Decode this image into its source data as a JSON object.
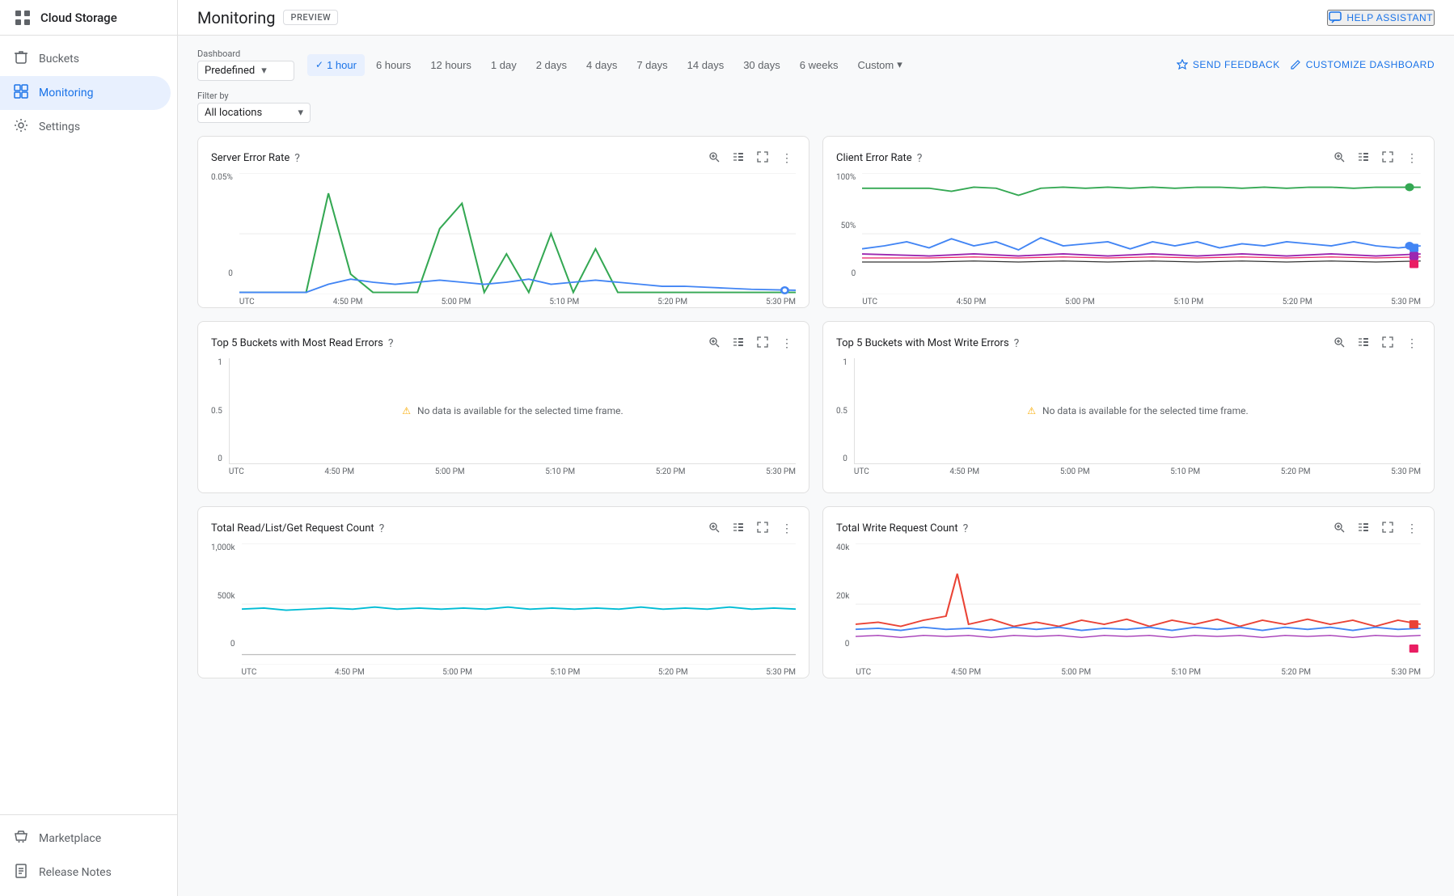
{
  "app": {
    "title": "Cloud Storage",
    "icon": "grid"
  },
  "topbar": {
    "page_title": "Monitoring",
    "preview_label": "PREVIEW",
    "help_assistant_label": "HELP ASSISTANT",
    "send_feedback_label": "SEND FEEDBACK",
    "customize_dashboard_label": "CUSTOMIZE DASHBOARD"
  },
  "sidebar": {
    "items": [
      {
        "id": "buckets",
        "label": "Buckets",
        "icon": "🪣"
      },
      {
        "id": "monitoring",
        "label": "Monitoring",
        "icon": "📊",
        "active": true
      },
      {
        "id": "settings",
        "label": "Settings",
        "icon": "⚙"
      }
    ],
    "footer_items": [
      {
        "id": "marketplace",
        "label": "Marketplace",
        "icon": "🛒"
      },
      {
        "id": "release-notes",
        "label": "Release Notes",
        "icon": "📋"
      }
    ]
  },
  "dashboard_controls": {
    "dashboard_label": "Dashboard",
    "dashboard_value": "Predefined",
    "filter_label": "Filter by",
    "filter_value": "All locations",
    "time_buttons": [
      {
        "id": "1hour",
        "label": "1 hour",
        "active": true
      },
      {
        "id": "6hours",
        "label": "6 hours",
        "active": false
      },
      {
        "id": "12hours",
        "label": "12 hours",
        "active": false
      },
      {
        "id": "1day",
        "label": "1 day",
        "active": false
      },
      {
        "id": "2days",
        "label": "2 days",
        "active": false
      },
      {
        "id": "4days",
        "label": "4 days",
        "active": false
      },
      {
        "id": "7days",
        "label": "7 days",
        "active": false
      },
      {
        "id": "14days",
        "label": "14 days",
        "active": false
      },
      {
        "id": "30days",
        "label": "30 days",
        "active": false
      },
      {
        "id": "6weeks",
        "label": "6 weeks",
        "active": false
      },
      {
        "id": "custom",
        "label": "Custom",
        "active": false,
        "has_arrow": true
      }
    ]
  },
  "charts": [
    {
      "id": "server-error-rate",
      "title": "Server Error Rate",
      "has_help": true,
      "type": "line",
      "y_max": "0.05%",
      "y_mid": "",
      "y_min": "0",
      "x_labels": [
        "UTC",
        "4:50 PM",
        "5:00 PM",
        "5:10 PM",
        "5:20 PM",
        "5:30 PM"
      ],
      "no_data": false
    },
    {
      "id": "client-error-rate",
      "title": "Client Error Rate",
      "has_help": true,
      "type": "line",
      "y_max": "100%",
      "y_mid": "50%",
      "y_min": "0",
      "x_labels": [
        "UTC",
        "4:50 PM",
        "5:00 PM",
        "5:10 PM",
        "5:20 PM",
        "5:30 PM"
      ],
      "no_data": false
    },
    {
      "id": "top5-read-errors",
      "title": "Top 5 Buckets with Most Read Errors",
      "has_help": true,
      "type": "no_data",
      "y_max": "1",
      "y_mid": "0.5",
      "y_min": "0",
      "x_labels": [
        "UTC",
        "4:50 PM",
        "5:00 PM",
        "5:10 PM",
        "5:20 PM",
        "5:30 PM"
      ],
      "no_data": true,
      "no_data_msg": "No data is available for the selected time frame."
    },
    {
      "id": "top5-write-errors",
      "title": "Top 5 Buckets with Most Write Errors",
      "has_help": true,
      "type": "no_data",
      "y_max": "1",
      "y_mid": "0.5",
      "y_min": "0",
      "x_labels": [
        "UTC",
        "4:50 PM",
        "5:00 PM",
        "5:10 PM",
        "5:20 PM",
        "5:30 PM"
      ],
      "no_data": true,
      "no_data_msg": "No data is available for the selected time frame."
    },
    {
      "id": "read-request-count",
      "title": "Total Read/List/Get Request Count",
      "has_help": true,
      "type": "line",
      "y_max": "1,000k",
      "y_mid": "500k",
      "y_min": "0",
      "x_labels": [
        "UTC",
        "4:50 PM",
        "5:00 PM",
        "5:10 PM",
        "5:20 PM",
        "5:30 PM"
      ],
      "no_data": false
    },
    {
      "id": "write-request-count",
      "title": "Total Write Request Count",
      "has_help": true,
      "type": "line",
      "y_max": "40k",
      "y_mid": "20k",
      "y_min": "0",
      "x_labels": [
        "UTC",
        "4:50 PM",
        "5:00 PM",
        "5:10 PM",
        "5:20 PM",
        "5:30 PM"
      ],
      "no_data": false
    }
  ],
  "colors": {
    "primary_blue": "#1a73e8",
    "active_nav_bg": "#e8f0fe",
    "sidebar_bg": "#ffffff",
    "card_bg": "#ffffff",
    "border": "#e0e0e0",
    "text_primary": "#202124",
    "text_secondary": "#5f6368"
  }
}
